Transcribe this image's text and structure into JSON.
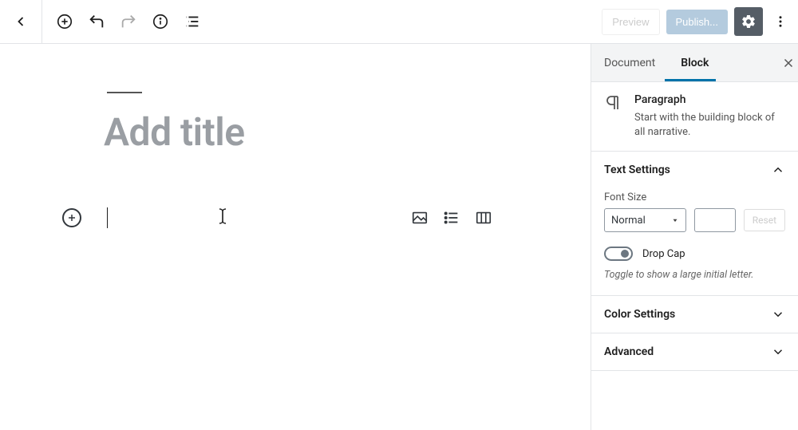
{
  "topbar": {
    "preview_label": "Preview",
    "publish_label": "Publish..."
  },
  "editor": {
    "title_placeholder": "Add title"
  },
  "sidebar": {
    "tabs": {
      "document": "Document",
      "block": "Block",
      "active": "block"
    },
    "block_header": {
      "name": "Paragraph",
      "description": "Start with the building block of all narrative."
    },
    "text_settings": {
      "title": "Text Settings",
      "font_size_label": "Font Size",
      "font_size_value": "Normal",
      "reset_label": "Reset",
      "drop_cap_label": "Drop Cap",
      "drop_cap_help": "Toggle to show a large initial letter."
    },
    "color_settings_title": "Color Settings",
    "advanced_title": "Advanced"
  }
}
